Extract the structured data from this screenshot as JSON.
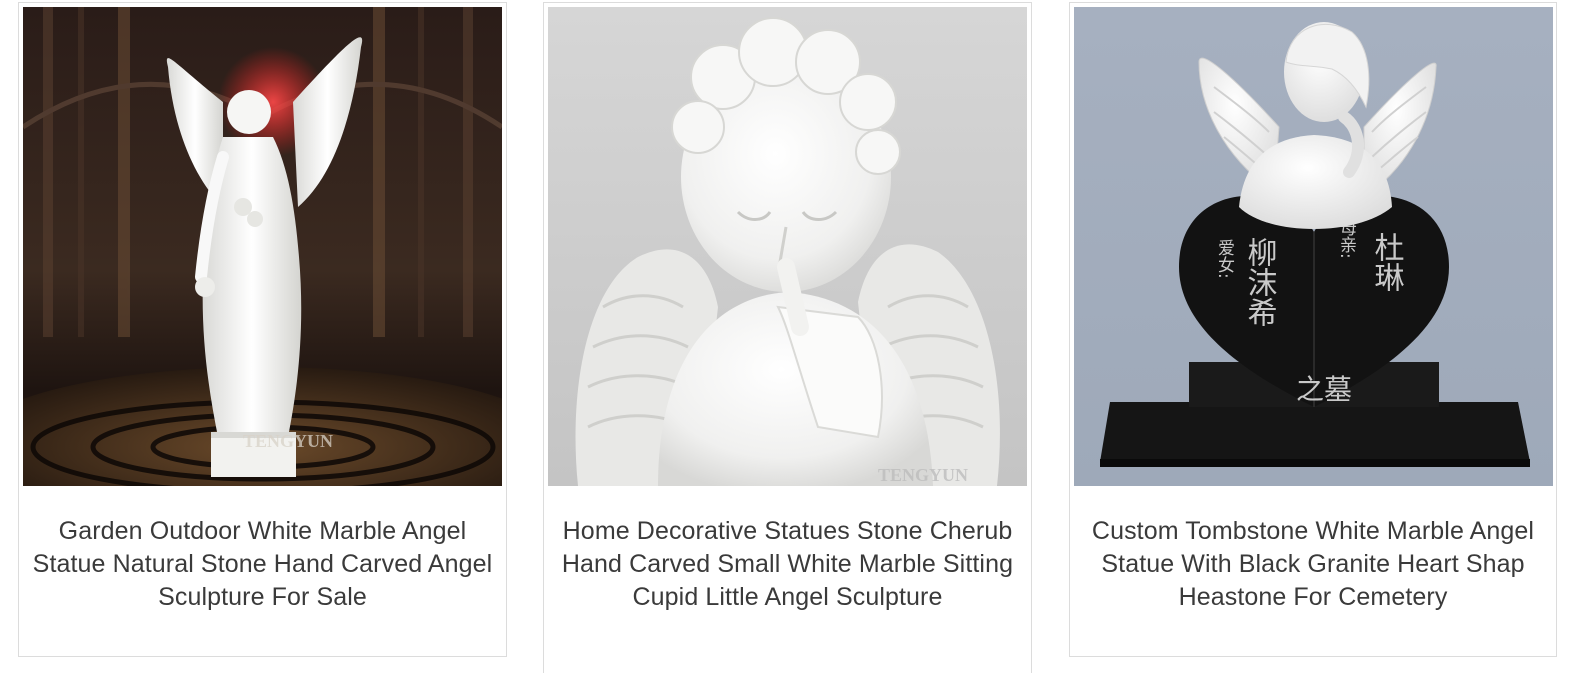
{
  "products": [
    {
      "title": "Garden Outdoor White Marble Angel Statue Natural Stone Hand Carved Angel Sculpture For Sale",
      "watermark": "TENGYUN",
      "image_icon": "standing-angel-statue-image"
    },
    {
      "title": "Home Decorative Statues Stone Cherub Hand Carved Small White Marble Sitting Cupid Little Angel Sculpture",
      "watermark": "TENGYUN",
      "image_icon": "cherub-statue-image"
    },
    {
      "title": "Custom Tombstone White Marble Angel Statue With Black Granite Heart Shap Heastone For Cemetery",
      "engraving": {
        "left_small": "爱女:",
        "left_big": "柳沫希",
        "right_small": "母亲:",
        "right_big": "杜琳",
        "bottom": "之墓"
      },
      "image_icon": "heart-headstone-angel-image"
    }
  ],
  "colors": {
    "text": "#3a3a3a",
    "border": "#dcdcdc",
    "marble": "#f4f4f4",
    "granite": "#111111",
    "backdrop_blue": "#a3aebf"
  }
}
